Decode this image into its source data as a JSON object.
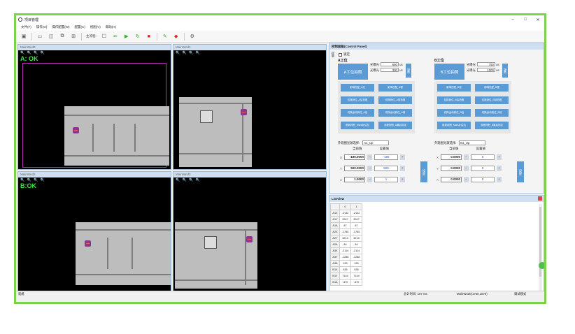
{
  "window": {
    "title": "项目管理",
    "controls": [
      "–",
      "□",
      "✕"
    ]
  },
  "menu": [
    "文件(F)",
    "操作(O)",
    "操作配置(W)",
    "配置(C)",
    "视图(V)",
    "帮助(H)"
  ],
  "toolbar": {
    "mode_label": "主流程:"
  },
  "views": [
    {
      "title": "MainWnd0",
      "status": "A: OK",
      "zoom": "🔍 🔍 🔍 🔍"
    },
    {
      "title": "MainWnd1",
      "status": "",
      "zoom": "🔍 🔍 🔍 🔍"
    },
    {
      "title": "MainWnd2",
      "status": "B:OK",
      "zoom": "🔍 🔍 🔍 🔍"
    },
    {
      "title": "MainWnd3",
      "status": "",
      "zoom": "🔍 🔍 🔍 🔍"
    }
  ],
  "panel": {
    "title": "控制面板(Control Panel)",
    "side_tab": "控制",
    "lock_label": "锁定",
    "stations": [
      {
        "title": "A工位",
        "photo": "A工位拍照",
        "exp1_label": "光曝光",
        "exp1": "650",
        "exp2_label": "光曝光",
        "exp2": "300",
        "unit": "us",
        "set": "设置",
        "buttons": [
          "影响匹配_A定",
          "影响匹配_A视",
          "切换到位_A后拍照",
          "切换到位_A前拍照",
          "切换运动到位_A后",
          "切换运动到位_A前",
          "更新判断_Mark补偿位",
          "流程判断_A最后标定"
        ],
        "cam_label": "外观图光源选择:",
        "cam": "A1_Up",
        "cur_hdr": "当前值",
        "set_hdr": "设置值",
        "axes": [
          {
            "axis": "X",
            "cur": "-185.0000",
            "tgt": "-185"
          },
          {
            "axis": "Y",
            "cur": "500.0000",
            "tgt": "500"
          },
          {
            "axis": "A",
            "cur": "1.0000",
            "tgt": "1"
          }
        ],
        "apply": "设定"
      },
      {
        "title": "B工位",
        "photo": "B工位拍照",
        "exp1_label": "光曝光",
        "exp1": "750",
        "exp2_label": "光曝光",
        "exp2": "1000",
        "unit": "us",
        "set": "设置",
        "buttons": [
          "影响匹配_B定",
          "影响匹配_B视",
          "切换到位_B后拍照",
          "切换到位_B前拍照",
          "切换运动到位_B后",
          "切换运动到位_B前",
          "更新判断_Mark补偿位",
          "流程判断_B最后标定"
        ],
        "cam_label": "外观图光源选择:",
        "cam": "B1_Up",
        "cur_hdr": "当前值",
        "set_hdr": "设置值",
        "axes": [
          {
            "axis": "X",
            "cur": "0.0000",
            "tgt": "0"
          },
          {
            "axis": "Y",
            "cur": "0.0000",
            "tgt": "0"
          },
          {
            "axis": "A",
            "cur": "0.0000",
            "tgt": "0"
          }
        ],
        "apply": "设定"
      }
    ]
  },
  "listview": {
    "title": "ListView",
    "columns": [
      "",
      "0",
      "1"
    ],
    "rows": [
      [
        "A1X",
        "-2142",
        "-2142"
      ],
      [
        "A1Y",
        "3947",
        "3947"
      ],
      [
        "A1A",
        "87",
        "87"
      ],
      [
        "A2X",
        "-1785",
        "-1785"
      ],
      [
        "A2Y",
        "3213",
        "3213"
      ],
      [
        "A2A",
        "84",
        "84"
      ],
      [
        "A3X",
        "-2114",
        "-2114"
      ],
      [
        "A3Y",
        "-1288",
        "-1288"
      ],
      [
        "A3A",
        "153",
        "153"
      ],
      [
        "B1X",
        "535",
        "535"
      ],
      [
        "B1Y",
        "7144",
        "7144"
      ],
      [
        "B1A",
        "-370",
        "-370"
      ]
    ]
  },
  "statusbar": {
    "left": "就绪",
    "mid": "总计时间: 107 ms",
    "coords": "MainWnd0(1760,1576)",
    "mode": "调试模式"
  }
}
